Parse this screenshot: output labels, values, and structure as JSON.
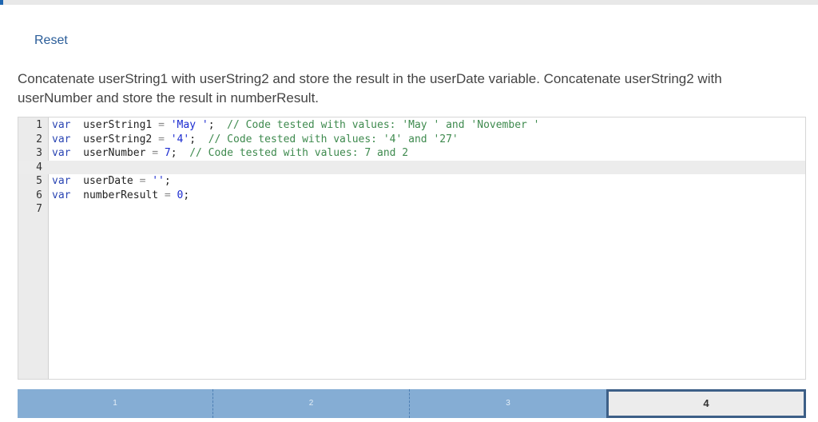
{
  "reset_label": "Reset",
  "instructions": "Concatenate userString1 with userString2 and store the result in the userDate variable. Concatenate userString2 with userNumber and store the result in numberResult.",
  "editor": {
    "active_line": 4,
    "lines": [
      {
        "n": "1",
        "tokens": [
          [
            "kw",
            "var"
          ],
          [
            "",
            "  userString1 "
          ],
          [
            "op",
            "="
          ],
          [
            "str",
            " 'May '"
          ],
          [
            "",
            ";  "
          ],
          [
            "cm",
            "// Code tested with values: 'May ' and 'November '"
          ]
        ]
      },
      {
        "n": "2",
        "tokens": [
          [
            "kw",
            "var"
          ],
          [
            "",
            "  userString2 "
          ],
          [
            "op",
            "="
          ],
          [
            "str",
            " '4'"
          ],
          [
            "",
            ";  "
          ],
          [
            "cm",
            "// Code tested with values: '4' and '27'"
          ]
        ]
      },
      {
        "n": "3",
        "tokens": [
          [
            "kw",
            "var"
          ],
          [
            "",
            "  userNumber "
          ],
          [
            "op",
            "="
          ],
          [
            "num",
            " 7"
          ],
          [
            "",
            ";  "
          ],
          [
            "cm",
            "// Code tested with values: 7 and 2"
          ]
        ]
      },
      {
        "n": "4",
        "tokens": []
      },
      {
        "n": "5",
        "tokens": [
          [
            "kw",
            "var"
          ],
          [
            "",
            "  userDate "
          ],
          [
            "op",
            "="
          ],
          [
            "str",
            " ''"
          ],
          [
            "",
            ";"
          ]
        ]
      },
      {
        "n": "6",
        "tokens": [
          [
            "kw",
            "var"
          ],
          [
            "",
            "  numberResult "
          ],
          [
            "op",
            "="
          ],
          [
            "num",
            " 0"
          ],
          [
            "",
            ";"
          ]
        ]
      },
      {
        "n": "7",
        "tokens": []
      }
    ]
  },
  "progress": {
    "steps": [
      "1",
      "2",
      "3",
      "4"
    ],
    "current": 4
  }
}
